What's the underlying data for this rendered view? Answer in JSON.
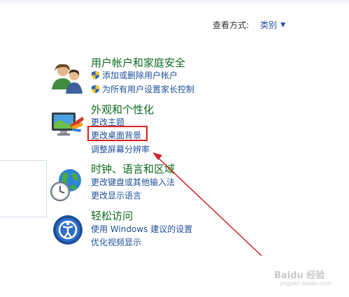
{
  "header": {
    "view_by_label": "查看方式:",
    "view_by_value": "类别"
  },
  "categories": [
    {
      "title": "用户帐户和家庭安全",
      "icon": "users-icon",
      "links": [
        "添加或删除用户帐户",
        "为所有用户设置家长控制"
      ]
    },
    {
      "title": "外观和个性化",
      "icon": "monitor-paint-icon",
      "links": [
        "更改主题",
        "更改桌面背景",
        "调整屏幕分辨率"
      ]
    },
    {
      "title": "时钟、语言和区域",
      "icon": "globe-clock-icon",
      "links": [
        "更改键盘或其他输入法",
        "更改显示语言"
      ]
    },
    {
      "title": "轻松访问",
      "icon": "ease-of-access-icon",
      "links": [
        "使用 Windows 建议的设置",
        "优化视频显示"
      ]
    }
  ],
  "annotation": {
    "highlight_color": "#e02020"
  },
  "watermark": {
    "text": "Baidu 经验",
    "sub": "jingyan.baidu.com"
  }
}
